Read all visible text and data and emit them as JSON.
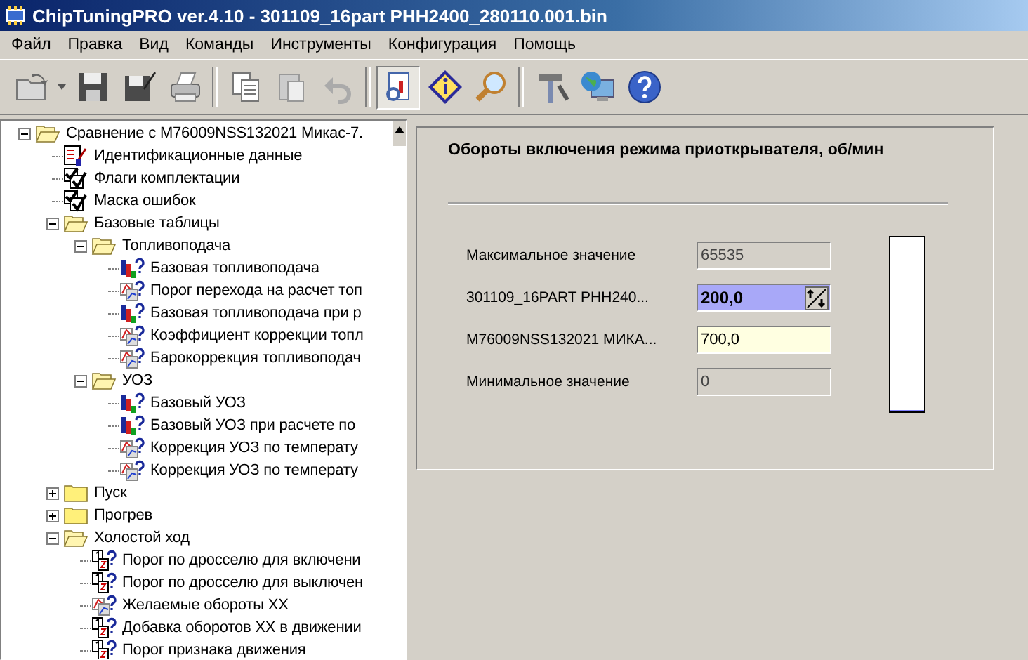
{
  "window": {
    "title": "ChipTuningPRO ver.4.10 - 301109_16part PHH2400_280110.001.bin"
  },
  "menu": [
    "Файл",
    "Правка",
    "Вид",
    "Команды",
    "Инструменты",
    "Конфигурация",
    "Помощь"
  ],
  "toolbar": [
    {
      "kind": "button",
      "pressed": false
    },
    {
      "kind": "dropdown",
      "pressed": false
    },
    {
      "kind": "button",
      "pressed": false
    },
    {
      "kind": "button",
      "pressed": false
    },
    {
      "kind": "button",
      "pressed": false
    },
    {
      "kind": "separator"
    },
    {
      "kind": "button",
      "pressed": false
    },
    {
      "kind": "button",
      "pressed": false
    },
    {
      "kind": "button",
      "pressed": false
    },
    {
      "kind": "separator"
    },
    {
      "kind": "button",
      "pressed": true
    },
    {
      "kind": "button",
      "pressed": false
    },
    {
      "kind": "button",
      "pressed": false
    },
    {
      "kind": "separator"
    },
    {
      "kind": "button",
      "pressed": false
    },
    {
      "kind": "button",
      "pressed": false
    },
    {
      "kind": "button",
      "pressed": false
    }
  ],
  "tree": [
    {
      "kind": "folder",
      "label": "Сравнение с M76009NSS132021 Микас-7.",
      "expanded": true,
      "children": [
        {
          "kind": "id-data",
          "label": "Идентификационные данные"
        },
        {
          "kind": "checklist",
          "label": "Флаги комплектации"
        },
        {
          "kind": "checklist",
          "label": "Маска ошибок"
        },
        {
          "kind": "folder",
          "label": "Базовые таблицы",
          "expanded": true,
          "children": [
            {
              "kind": "folder",
              "label": "Топливоподача",
              "expanded": true,
              "children": [
                {
                  "kind": "bar-chart",
                  "label": "Базовая топливоподача"
                },
                {
                  "kind": "line-chart",
                  "label": "Порог перехода на расчет топ"
                },
                {
                  "kind": "bar-chart",
                  "label": "Базовая топливоподача при р"
                },
                {
                  "kind": "line-chart",
                  "label": "Коэффициент коррекции топл"
                },
                {
                  "kind": "line-chart",
                  "label": "Барокоррекция топливоподач"
                }
              ]
            },
            {
              "kind": "folder",
              "label": "УОЗ",
              "expanded": true,
              "children": [
                {
                  "kind": "bar-chart",
                  "label": "Базовый УОЗ"
                },
                {
                  "kind": "bar-chart",
                  "label": "Базовый УОЗ при расчете по"
                },
                {
                  "kind": "line-chart",
                  "label": "Коррекция УОЗ по температу"
                },
                {
                  "kind": "line-chart",
                  "label": "Коррекция УОЗ по температу"
                }
              ]
            }
          ]
        },
        {
          "kind": "folder",
          "label": "Пуск",
          "expanded": false
        },
        {
          "kind": "folder",
          "label": "Прогрев",
          "expanded": false
        },
        {
          "kind": "folder",
          "label": "Холостой ход",
          "expanded": true,
          "children": [
            {
              "kind": "number-table",
              "label": "Порог по дросселю для включени"
            },
            {
              "kind": "number-table",
              "label": "Порог по дросселю для выключен"
            },
            {
              "kind": "line-chart",
              "label": "Желаемые обороты ХХ"
            },
            {
              "kind": "number-table",
              "label": "Добавка оборотов ХХ в движении"
            },
            {
              "kind": "number-table",
              "label": "Порог признака движения"
            }
          ]
        }
      ]
    }
  ],
  "panel": {
    "title": "Обороты включения режима приоткрывателя, об/мин",
    "fields": [
      {
        "label": "Максимальное значение",
        "value": "65535",
        "kind": "readonly",
        "selected": false
      },
      {
        "label": "301109_16PART PHH240...",
        "value": "200,0",
        "kind": "spin",
        "selected": true
      },
      {
        "label": "M76009NSS132021 МИКА...",
        "value": "700,0",
        "kind": "compare",
        "selected": false
      },
      {
        "label": "Минимальное значение",
        "value": "0",
        "kind": "readonly",
        "selected": false
      }
    ],
    "meter": {
      "level": 0.01
    }
  }
}
